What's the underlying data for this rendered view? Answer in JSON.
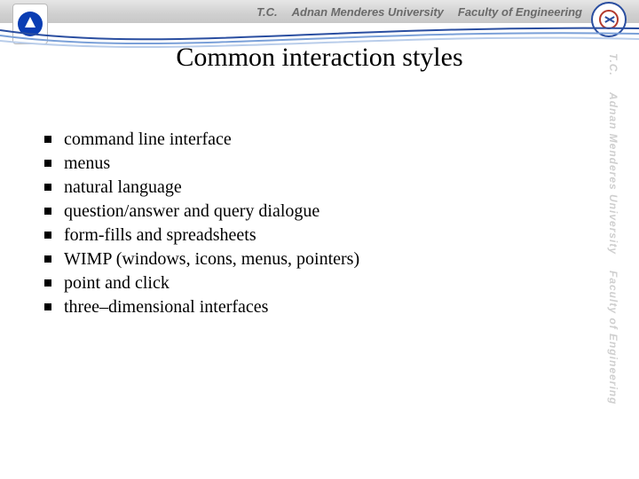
{
  "header": {
    "left_text": "T.C.",
    "center_text": "Adnan Menderes University",
    "right_text": "Faculty of Engineering"
  },
  "title": "Common interaction styles",
  "bullets": [
    "command line interface",
    "menus",
    "natural language",
    "question/answer and query dialogue",
    "form-fills and spreadsheets",
    "WIMP (windows, icons, menus, pointers)",
    "point and click",
    "three–dimensional interfaces"
  ],
  "side_watermark": {
    "a": "T.C.",
    "b": "Adnan Menderes University",
    "c": "Faculty of Engineering"
  }
}
